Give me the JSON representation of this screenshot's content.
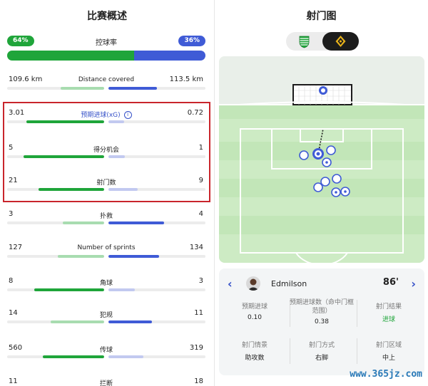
{
  "left_panel": {
    "title": "比赛概述",
    "possession": {
      "label": "控球率",
      "home": "64%",
      "away": "36%",
      "home_fraction": 0.64
    },
    "stats": [
      {
        "label": "Distance covered",
        "home": "109.6 km",
        "away": "113.5 km",
        "home_fill": 0.45,
        "away_fill": 0.5,
        "home_leads": false,
        "info": false
      },
      {
        "label": "预期进球(xG)",
        "home": "3.01",
        "away": "0.72",
        "home_fill": 0.8,
        "away_fill": 0.16,
        "home_leads": true,
        "info": true
      },
      {
        "label": "得分机会",
        "home": "5",
        "away": "1",
        "home_fill": 0.83,
        "away_fill": 0.17,
        "home_leads": true,
        "info": false
      },
      {
        "label": "射门数",
        "home": "21",
        "away": "9",
        "home_fill": 0.68,
        "away_fill": 0.3,
        "home_leads": true,
        "info": false
      },
      {
        "label": "扑救",
        "home": "3",
        "away": "4",
        "home_fill": 0.43,
        "away_fill": 0.57,
        "home_leads": false,
        "info": false
      },
      {
        "label": "Number of sprints",
        "home": "127",
        "away": "134",
        "home_fill": 0.48,
        "away_fill": 0.52,
        "home_leads": false,
        "info": false
      },
      {
        "label": "角球",
        "home": "8",
        "away": "3",
        "home_fill": 0.72,
        "away_fill": 0.27,
        "home_leads": true,
        "info": false
      },
      {
        "label": "犯规",
        "home": "14",
        "away": "11",
        "home_fill": 0.55,
        "away_fill": 0.45,
        "home_leads": false,
        "info": false
      },
      {
        "label": "传球",
        "home": "560",
        "away": "319",
        "home_fill": 0.63,
        "away_fill": 0.36,
        "home_leads": true,
        "info": false
      },
      {
        "label": "拦断",
        "home": "11",
        "away": "18",
        "home_fill": 0.38,
        "away_fill": 0.62,
        "home_leads": false,
        "info": false
      }
    ]
  },
  "right_panel": {
    "title": "射门图",
    "team_toggle": [
      {
        "team": "home",
        "icon": "sporting-crest-icon",
        "selected": false
      },
      {
        "team": "away",
        "icon": "away-crest-icon",
        "selected": true
      }
    ],
    "shot_card": {
      "player": "Edmilson",
      "minute": "86'",
      "metrics": [
        {
          "label": "预期进球",
          "value": "0.10"
        },
        {
          "label": "预期进球数（命中门框范围）",
          "value": "0.38"
        },
        {
          "label": "射门结果",
          "value": "进球",
          "highlight": true
        },
        {
          "label": "射门情景",
          "value": "助攻数"
        },
        {
          "label": "射门方式",
          "value": "右脚"
        },
        {
          "label": "射门区域",
          "value": "中上"
        }
      ]
    }
  },
  "colors": {
    "home": "#1fa53a",
    "home_light": "#a8dcb0",
    "away": "#3f5bd6",
    "away_light": "#c2c9f0",
    "highlight_border": "#c9252c",
    "pitch_green": "#c7e9bf"
  },
  "watermark": "www.365jz.com"
}
